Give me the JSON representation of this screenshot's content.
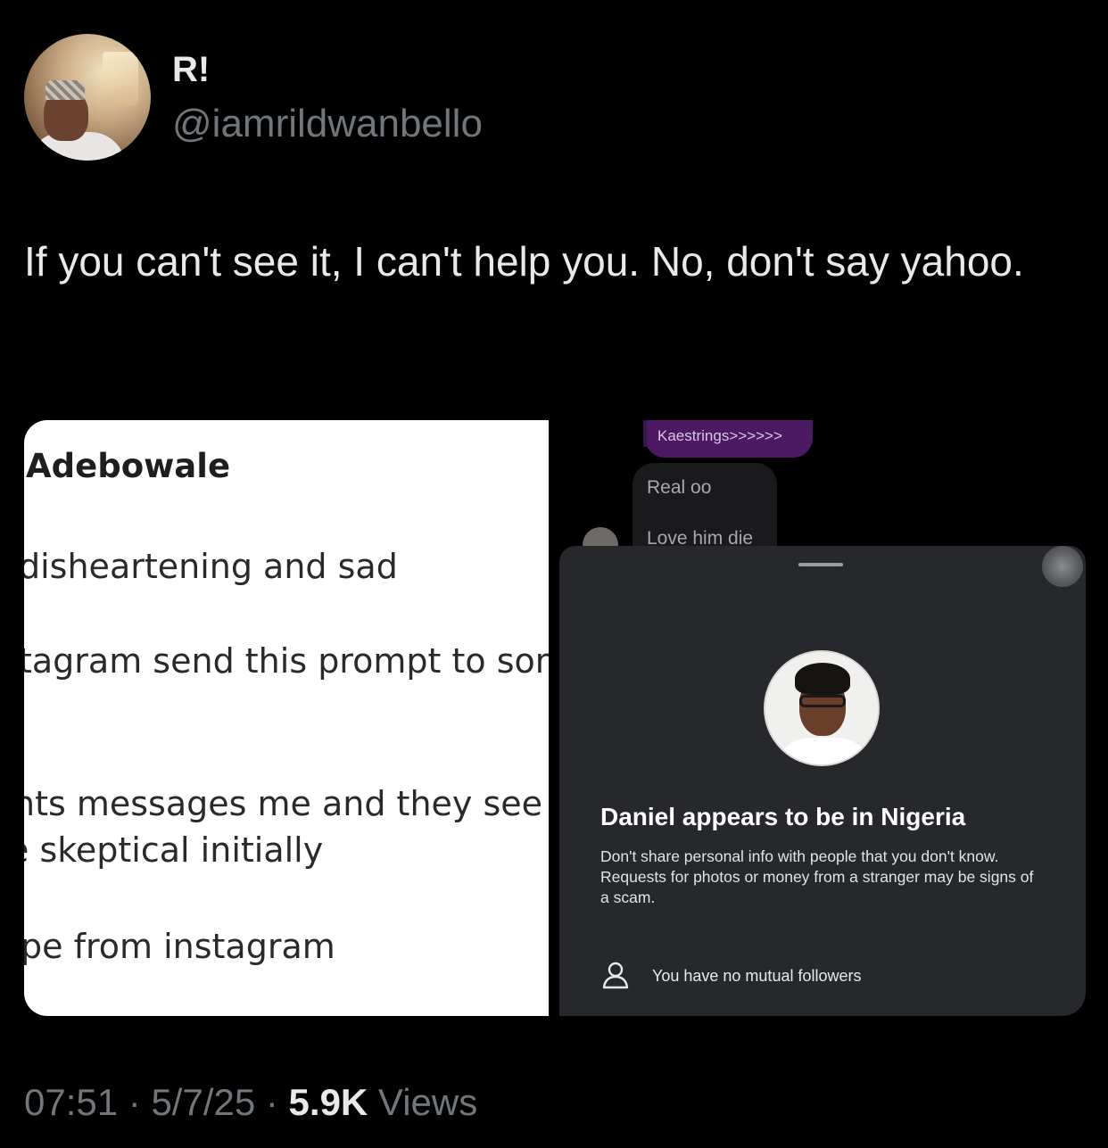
{
  "author": {
    "display_name": "R!",
    "handle": "@iamrildwanbello"
  },
  "tweet": {
    "text": "If you can't see it, I can't help you. No, don't say yahoo."
  },
  "left_image": {
    "title": "Adebowale",
    "lines": [
      "disheartening and sad",
      "tagram send this prompt to som",
      "nts messages me and they see th",
      "e skeptical initially",
      "pe from instagram"
    ]
  },
  "right_image": {
    "chat_messages": [
      "Kaestrings>>>>>>",
      "Real oo",
      "Love him die"
    ],
    "sheet": {
      "title": "Daniel appears to be in Nigeria",
      "body": "Don't share personal info with people that you don't know. Requests for photos or money from a stranger may be signs of a scam.",
      "mutual_icon": "person-icon",
      "mutual_text": "You have no mutual followers"
    }
  },
  "footer": {
    "time": "07:51",
    "sep1": " · ",
    "date": "5/7/25",
    "sep2": " · ",
    "views_count": "5.9K",
    "views_label": " Views"
  }
}
